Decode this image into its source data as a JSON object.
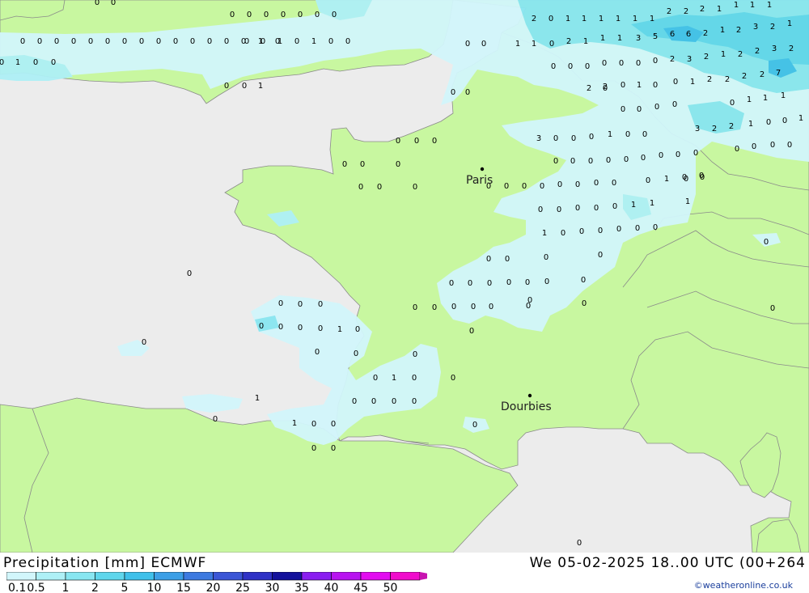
{
  "header": {
    "title": "Precipitation [mm] ECMWF",
    "validity": "We 05-02-2025 18..00 UTC (00+264",
    "credit": "©weatheronline.co.uk"
  },
  "colors": {
    "sea": "#ececec",
    "land": "#c8f7a0",
    "border": "#8a8a8a",
    "precip": [
      "#d2f6fb",
      "#aef0f6",
      "#88e6f1",
      "#5fd6ec",
      "#3fc0ea",
      "#3c9fe6",
      "#3d7ae0",
      "#3b56d6",
      "#2f32c6",
      "#14129c",
      "#8a1ef0",
      "#b814f0",
      "#e20cf0",
      "#f00ccc",
      "#c814b0"
    ]
  },
  "legend": {
    "labels": [
      "0.1",
      "0.5",
      "1",
      "2",
      "5",
      "10",
      "15",
      "20",
      "25",
      "30",
      "35",
      "40",
      "45",
      "50"
    ]
  },
  "cities": [
    {
      "name": "Paris"
    },
    {
      "name": "Dourbies"
    }
  ],
  "grid_values": [
    {
      "v": "0"
    },
    {
      "v": "0"
    },
    {
      "v": "0"
    },
    {
      "v": "0"
    },
    {
      "v": "0"
    },
    {
      "v": "0"
    },
    {
      "v": "0"
    },
    {
      "v": "0"
    },
    {
      "v": "0"
    },
    {
      "v": "0"
    },
    {
      "v": "0"
    },
    {
      "v": "0"
    },
    {
      "v": "0"
    },
    {
      "v": "0"
    },
    {
      "v": "0"
    },
    {
      "v": "0"
    },
    {
      "v": "0"
    },
    {
      "v": "0"
    },
    {
      "v": "0"
    },
    {
      "v": "0"
    },
    {
      "v": "0"
    },
    {
      "v": "1"
    },
    {
      "v": "0"
    },
    {
      "v": "0"
    },
    {
      "v": "1"
    },
    {
      "v": "0"
    },
    {
      "v": "0"
    },
    {
      "v": "0"
    },
    {
      "v": "0"
    },
    {
      "v": "1"
    },
    {
      "v": "0"
    },
    {
      "v": "0"
    },
    {
      "v": "1"
    },
    {
      "v": "0"
    },
    {
      "v": "1"
    },
    {
      "v": "0"
    },
    {
      "v": "0"
    },
    {
      "v": "0"
    },
    {
      "v": "0"
    },
    {
      "v": "0"
    },
    {
      "v": "0"
    },
    {
      "v": "0"
    },
    {
      "v": "0"
    },
    {
      "v": "2"
    },
    {
      "v": "0"
    },
    {
      "v": "1"
    },
    {
      "v": "1"
    },
    {
      "v": "1"
    },
    {
      "v": "1"
    },
    {
      "v": "1"
    },
    {
      "v": "1"
    },
    {
      "v": "2"
    },
    {
      "v": "2"
    },
    {
      "v": "2"
    },
    {
      "v": "1"
    },
    {
      "v": "1"
    },
    {
      "v": "1"
    },
    {
      "v": "1"
    },
    {
      "v": "1"
    },
    {
      "v": "1"
    },
    {
      "v": "0"
    },
    {
      "v": "2"
    },
    {
      "v": "1"
    },
    {
      "v": "1"
    },
    {
      "v": "1"
    },
    {
      "v": "3"
    },
    {
      "v": "5"
    },
    {
      "v": "6"
    },
    {
      "v": "6"
    },
    {
      "v": "2"
    },
    {
      "v": "1"
    },
    {
      "v": "2"
    },
    {
      "v": "3"
    },
    {
      "v": "2"
    },
    {
      "v": "1"
    },
    {
      "v": "0"
    },
    {
      "v": "0"
    },
    {
      "v": "0"
    },
    {
      "v": "0"
    },
    {
      "v": "0"
    },
    {
      "v": "0"
    },
    {
      "v": "0"
    },
    {
      "v": "2"
    },
    {
      "v": "3"
    },
    {
      "v": "2"
    },
    {
      "v": "1"
    },
    {
      "v": "2"
    },
    {
      "v": "2"
    },
    {
      "v": "3"
    },
    {
      "v": "2"
    },
    {
      "v": "2"
    },
    {
      "v": "0"
    },
    {
      "v": "1"
    },
    {
      "v": "0"
    },
    {
      "v": "0"
    },
    {
      "v": "1"
    },
    {
      "v": "2"
    },
    {
      "v": "2"
    },
    {
      "v": "2"
    },
    {
      "v": "2"
    },
    {
      "v": "7"
    },
    {
      "v": "2"
    },
    {
      "v": "0"
    },
    {
      "v": "0"
    },
    {
      "v": "0"
    },
    {
      "v": "0"
    },
    {
      "v": "0"
    },
    {
      "v": "0"
    },
    {
      "v": "1"
    },
    {
      "v": "1"
    },
    {
      "v": "1"
    },
    {
      "v": "3"
    },
    {
      "v": "2"
    },
    {
      "v": "2"
    },
    {
      "v": "1"
    },
    {
      "v": "0"
    },
    {
      "v": "0"
    },
    {
      "v": "1"
    },
    {
      "v": "3"
    },
    {
      "v": "0"
    },
    {
      "v": "0"
    },
    {
      "v": "0"
    },
    {
      "v": "1"
    },
    {
      "v": "0"
    },
    {
      "v": "0"
    },
    {
      "v": "0"
    },
    {
      "v": "0"
    },
    {
      "v": "0"
    },
    {
      "v": "0"
    },
    {
      "v": "0"
    },
    {
      "v": "0"
    },
    {
      "v": "0"
    },
    {
      "v": "0"
    },
    {
      "v": "0"
    },
    {
      "v": "0"
    },
    {
      "v": "0"
    },
    {
      "v": "0"
    },
    {
      "v": "0"
    },
    {
      "v": "0"
    },
    {
      "v": "0"
    },
    {
      "v": "0"
    },
    {
      "v": "0"
    },
    {
      "v": "0"
    },
    {
      "v": "0"
    },
    {
      "v": "0"
    },
    {
      "v": "0"
    },
    {
      "v": "0"
    },
    {
      "v": "0"
    },
    {
      "v": "0"
    },
    {
      "v": "0"
    },
    {
      "v": "0"
    },
    {
      "v": "0"
    },
    {
      "v": "0"
    },
    {
      "v": "0"
    },
    {
      "v": "0"
    },
    {
      "v": "0"
    },
    {
      "v": "0"
    },
    {
      "v": "0"
    },
    {
      "v": "1"
    },
    {
      "v": "0"
    },
    {
      "v": "0"
    },
    {
      "v": "1"
    },
    {
      "v": "0"
    },
    {
      "v": "0"
    },
    {
      "v": "0"
    },
    {
      "v": "0"
    },
    {
      "v": "0"
    },
    {
      "v": "1"
    },
    {
      "v": "1"
    },
    {
      "v": "1"
    },
    {
      "v": "0"
    },
    {
      "v": "0"
    },
    {
      "v": "0"
    },
    {
      "v": "0"
    },
    {
      "v": "0"
    },
    {
      "v": "0"
    },
    {
      "v": "0"
    },
    {
      "v": "0"
    },
    {
      "v": "0"
    },
    {
      "v": "0"
    },
    {
      "v": "0"
    },
    {
      "v": "0"
    },
    {
      "v": "0"
    },
    {
      "v": "0"
    },
    {
      "v": "0"
    },
    {
      "v": "0"
    },
    {
      "v": "0"
    },
    {
      "v": "0"
    },
    {
      "v": "0"
    },
    {
      "v": "0"
    },
    {
      "v": "0"
    },
    {
      "v": "0"
    },
    {
      "v": "0"
    },
    {
      "v": "0"
    },
    {
      "v": "0"
    },
    {
      "v": "0"
    },
    {
      "v": "0"
    },
    {
      "v": "0"
    },
    {
      "v": "0"
    },
    {
      "v": "0"
    },
    {
      "v": "0"
    },
    {
      "v": "0"
    },
    {
      "v": "0"
    },
    {
      "v": "1"
    },
    {
      "v": "0"
    },
    {
      "v": "0"
    },
    {
      "v": "0"
    },
    {
      "v": "0"
    },
    {
      "v": "0"
    },
    {
      "v": "0"
    },
    {
      "v": "0"
    },
    {
      "v": "1"
    },
    {
      "v": "0"
    },
    {
      "v": "0"
    },
    {
      "v": "0"
    },
    {
      "v": "0"
    },
    {
      "v": "0"
    },
    {
      "v": "0"
    },
    {
      "v": "1"
    },
    {
      "v": "0"
    },
    {
      "v": "1"
    },
    {
      "v": "0"
    },
    {
      "v": "0"
    },
    {
      "v": "0"
    },
    {
      "v": "0"
    },
    {
      "v": "0"
    },
    {
      "v": "0"
    },
    {
      "v": "0"
    },
    {
      "v": "0"
    },
    {
      "v": "0"
    }
  ]
}
